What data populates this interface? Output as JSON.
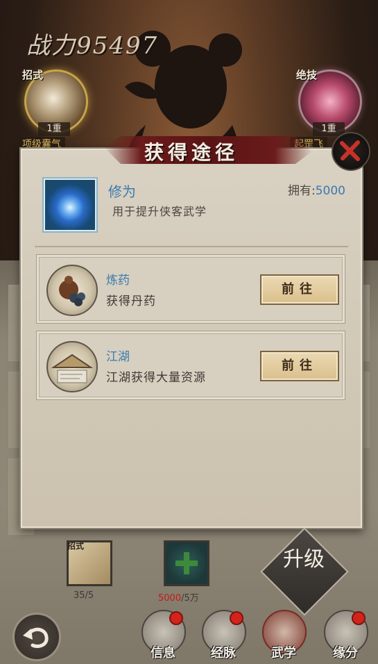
{
  "header": {
    "power_label": "战力",
    "power_value": "95497",
    "skill_left": {
      "tag": "招式",
      "level": "1重",
      "name": "项级囊气"
    },
    "skill_right": {
      "tag": "绝技",
      "level": "1重",
      "name": "起罡飞"
    }
  },
  "dialog": {
    "title": "获得途径",
    "item": {
      "name": "修为",
      "owned_label": "拥有:",
      "owned_value": "5000",
      "description": "用于提升侠客武学"
    },
    "sources": [
      {
        "title": "炼药",
        "description": "获得丹药",
        "button": "前往",
        "icon": "medicine-icon"
      },
      {
        "title": "江湖",
        "description": "江湖获得大量资源",
        "button": "前往",
        "icon": "jianghu-hat-icon"
      }
    ]
  },
  "materials": {
    "left": {
      "tag": "招式",
      "count": "35/5"
    },
    "mid": {
      "have": "5000",
      "need": "/5万"
    }
  },
  "upgrade_label": "升级",
  "nav": [
    {
      "label": "信息",
      "badge": true
    },
    {
      "label": "经脉",
      "badge": true
    },
    {
      "label": "武学",
      "badge": false
    },
    {
      "label": "缘分",
      "badge": true
    }
  ],
  "colors": {
    "accent_blue": "#3a7ab0",
    "title_red": "#5a1414",
    "warning_red": "#c21b1b"
  }
}
